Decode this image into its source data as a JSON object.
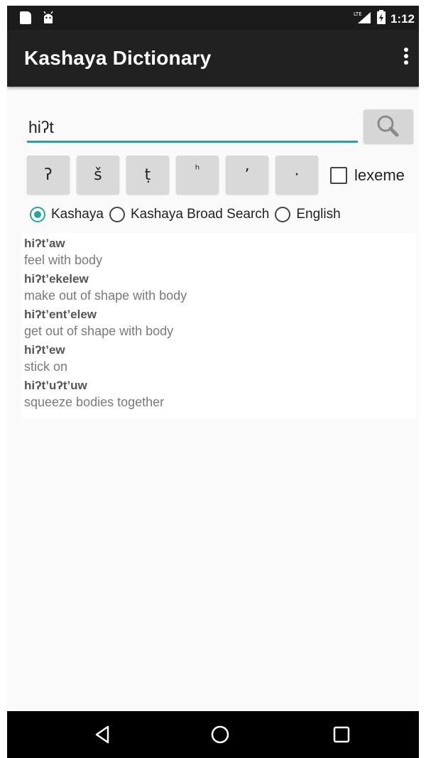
{
  "status_bar": {
    "time": "1:12",
    "network": "LTE"
  },
  "app_bar": {
    "title": "Kashaya Dictionary",
    "overflow_icon": "more-vert-icon"
  },
  "search": {
    "value": "hiʔt",
    "button_icon": "search-icon"
  },
  "keys": [
    "ʔ",
    "š",
    "ṭ",
    "ʰ",
    "ʼ",
    "·"
  ],
  "lexeme": {
    "label": "lexeme",
    "checked": false
  },
  "radio_options": [
    {
      "label": "Kashaya",
      "checked": true
    },
    {
      "label": "Kashaya Broad Search",
      "checked": false
    },
    {
      "label": "English",
      "checked": false
    }
  ],
  "results": [
    {
      "word": "hiʔt’aw",
      "definition": "feel with body"
    },
    {
      "word": "hiʔt’ekelew",
      "definition": "make out of shape with body"
    },
    {
      "word": "hiʔt’ent’elew",
      "definition": "get out of shape with body"
    },
    {
      "word": "hiʔt’ew",
      "definition": "stick on"
    },
    {
      "word": "hiʔt’uʔt’uw",
      "definition": "squeeze bodies together"
    }
  ],
  "colors": {
    "accent": "#26a69a",
    "app_bar": "#212121",
    "status_bar": "#1b1b1b"
  },
  "nav": {
    "back_icon": "back-icon",
    "home_icon": "home-icon",
    "recent_icon": "recent-apps-icon"
  }
}
